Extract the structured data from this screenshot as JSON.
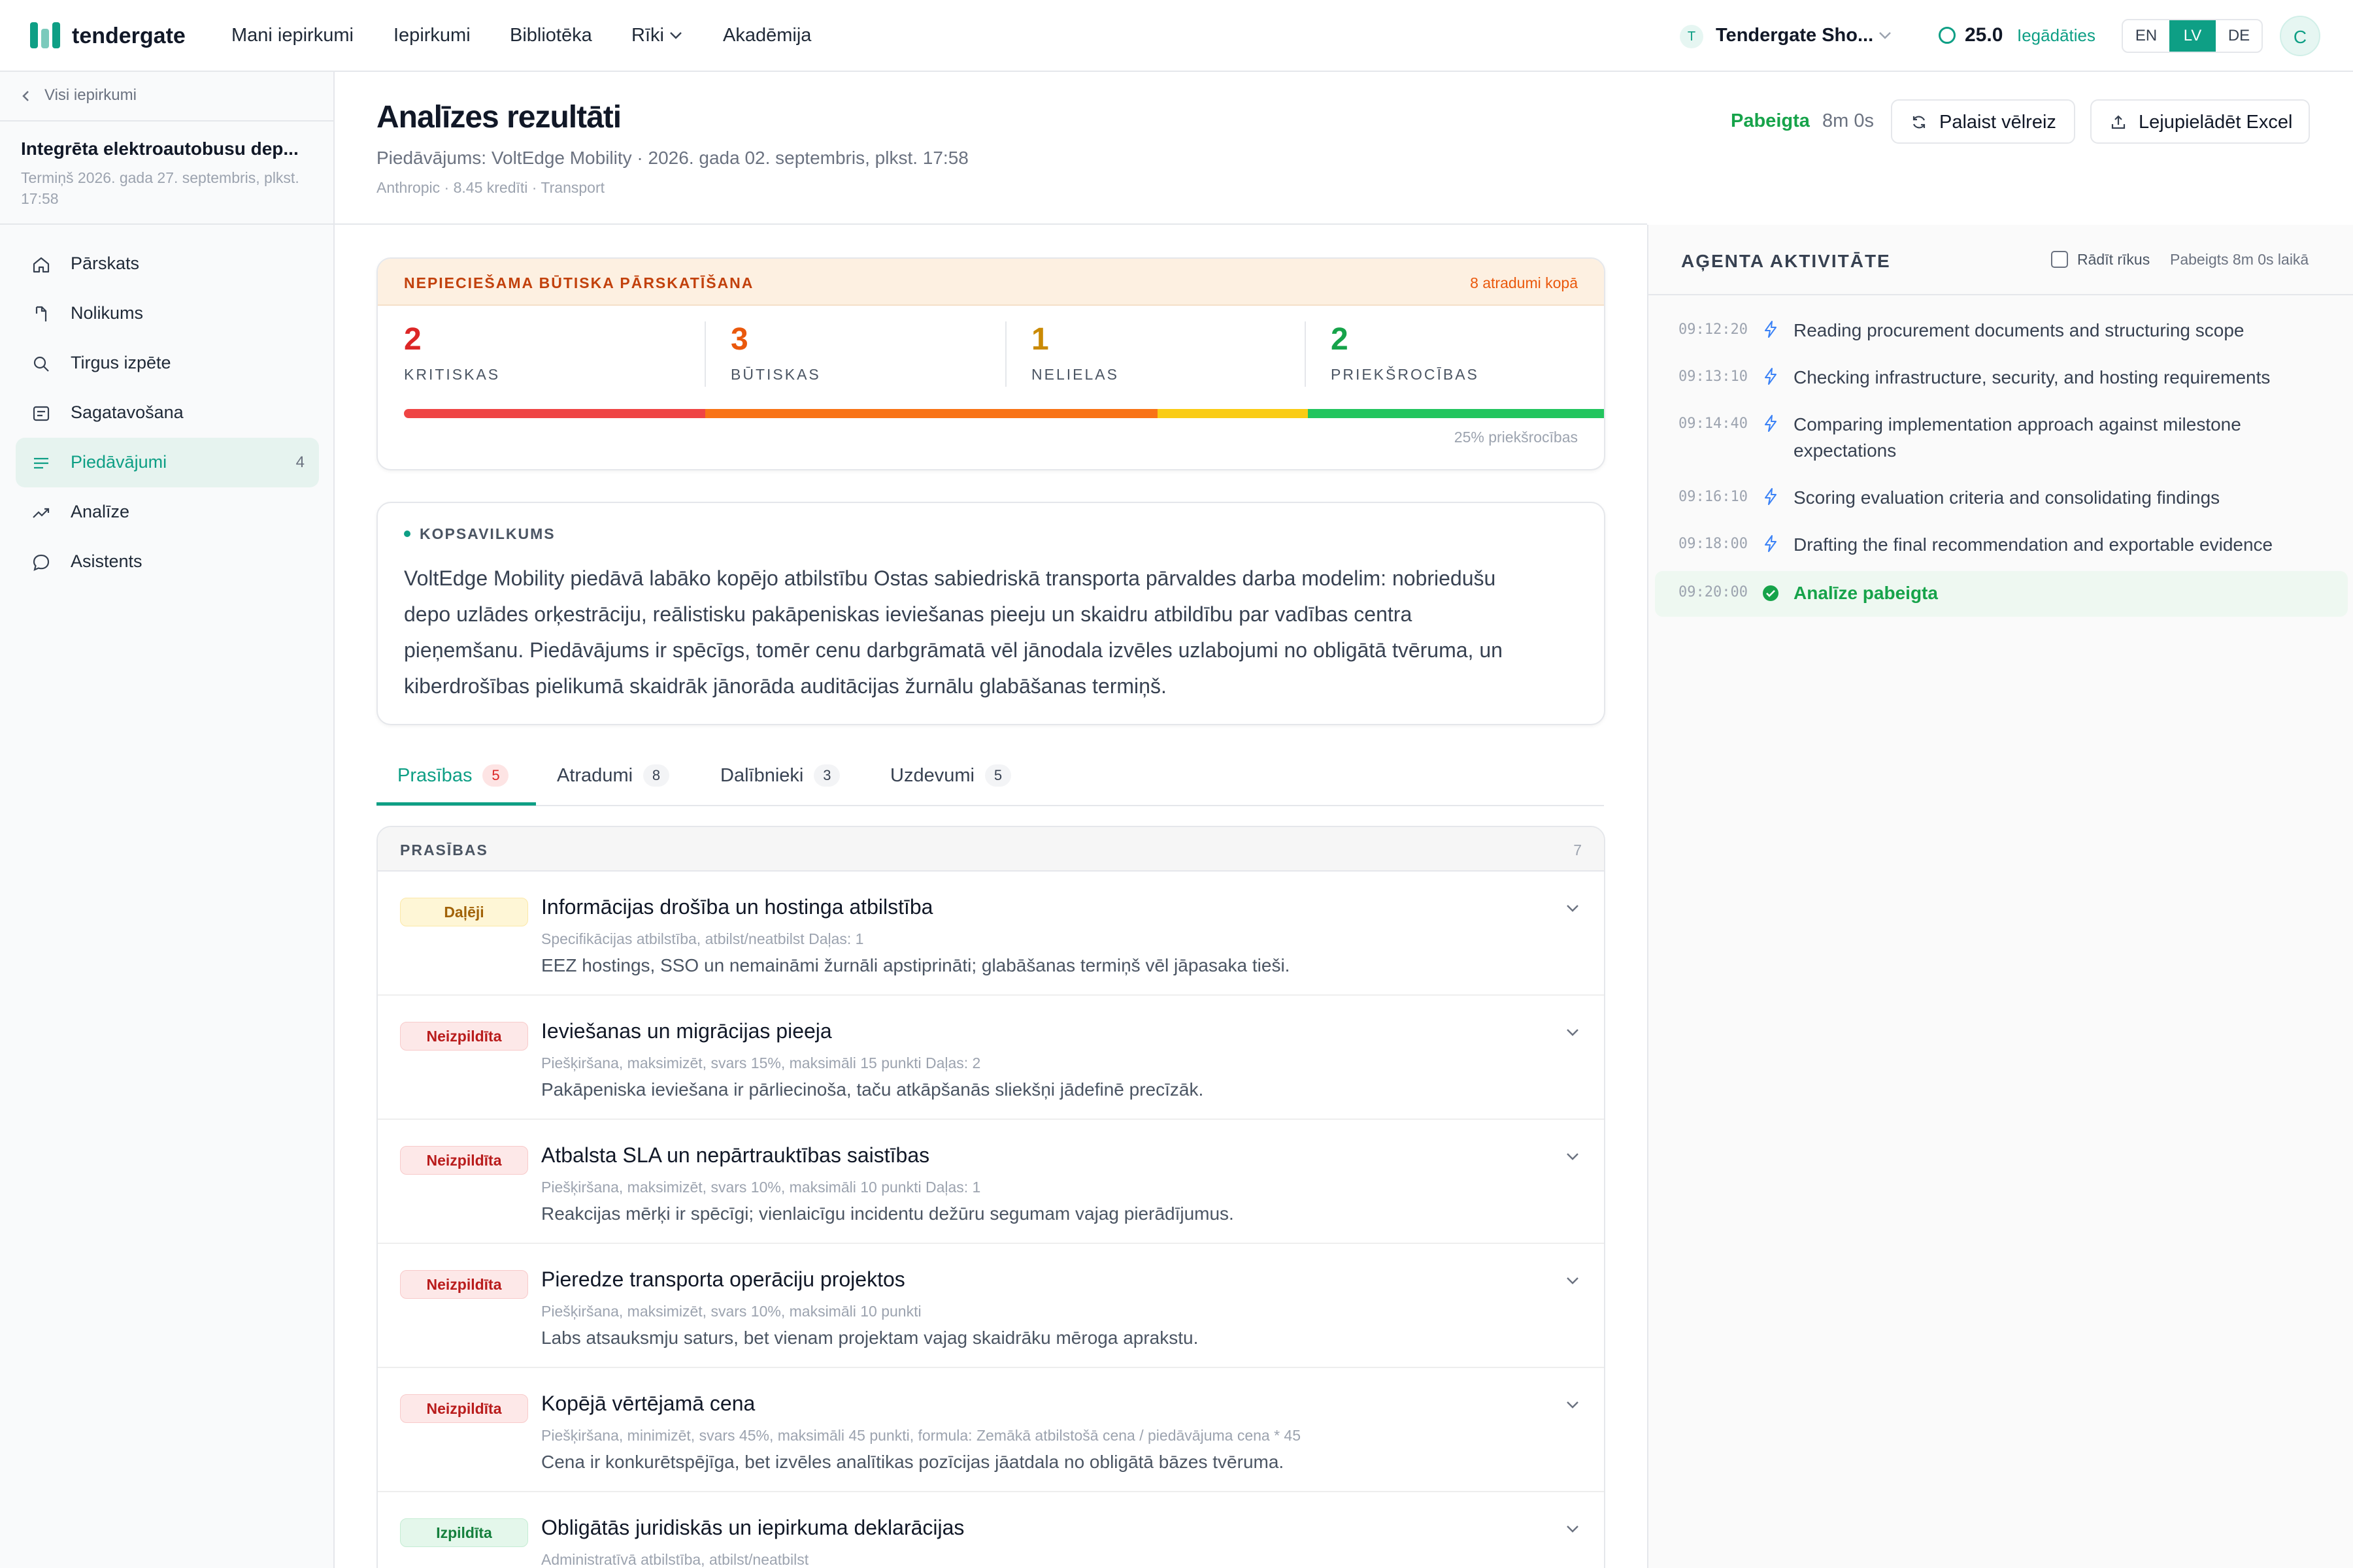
{
  "topbar": {
    "brand": "tendergate",
    "nav": [
      "Mani iepirkumi",
      "Iepirkumi",
      "Bibliotēka",
      "Rīki",
      "Akadēmija"
    ],
    "workspace_initial": "T",
    "workspace_name": "Tendergate Sho...",
    "credits": "25.0",
    "credits_link": "Iegādāties",
    "languages": [
      "EN",
      "LV",
      "DE"
    ],
    "active_language": "LV",
    "user_initial": "C"
  },
  "sidebar": {
    "back_label": "Visi iepirkumi",
    "project_title": "Integrēta elektroautobusu dep...",
    "project_deadline": "Termiņš 2026. gada 27. septembris, plkst. 17:58",
    "items": [
      {
        "label": "Pārskats",
        "icon": "home-icon"
      },
      {
        "label": "Nolikums",
        "icon": "document-icon"
      },
      {
        "label": "Tirgus izpēte",
        "icon": "search-icon"
      },
      {
        "label": "Sagatavošana",
        "icon": "form-icon"
      },
      {
        "label": "Piedāvājumi",
        "icon": "list-icon",
        "count": "4",
        "active": true
      },
      {
        "label": "Analīze",
        "icon": "trend-icon"
      },
      {
        "label": "Asistents",
        "icon": "chat-icon"
      }
    ]
  },
  "header": {
    "title": "Analīzes rezultāti",
    "meta": "Piedāvājums: VoltEdge Mobility · 2026. gada 02. septembris, plkst. 17:58",
    "tags": "Anthropic  ·  8.45 kredīti  ·  Transport",
    "status": "Pabeigta",
    "duration": "8m 0s",
    "rerun_label": "Palaist vēlreiz",
    "download_label": "Lejupielādēt Excel"
  },
  "severity": {
    "title": "NEPIECIEŠAMA BŪTISKA PĀRSKATĪŠANA",
    "total": "8 atradumi kopā",
    "stats": [
      {
        "value": "2",
        "label": "KRITISKAS",
        "color": "#dc2626"
      },
      {
        "value": "3",
        "label": "BŪTISKAS",
        "color": "#ea580c"
      },
      {
        "value": "1",
        "label": "NELIELAS",
        "color": "#ca8a04"
      },
      {
        "value": "2",
        "label": "PRIEKŠROCĪBAS",
        "color": "#16a34a"
      }
    ],
    "bar_colors": [
      "#ef4444",
      "#f97316",
      "#facc15",
      "#22c55e"
    ],
    "note": "25% priekšrocības"
  },
  "summary": {
    "heading": "KOPSAVILKUMS",
    "text": "VoltEdge Mobility piedāvā labāko kopējo atbilstību Ostas sabiedriskā transporta pārvaldes darba modelim: nobriedušu depo uzlādes orķestrāciju, reālistisku pakāpeniskas ieviešanas pieeju un skaidru atbildību par vadības centra pieņemšanu. Piedāvājums ir spēcīgs, tomēr cenu darbgrāmatā vēl jānodala izvēles uzlabojumi no obligātā tvēruma, un kiberdrošības pielikumā skaidrāk jānorāda auditācijas žurnālu glabāšanas termiņš."
  },
  "tabs": [
    {
      "label": "Prasības",
      "count": "5",
      "active": true
    },
    {
      "label": "Atradumi",
      "count": "8"
    },
    {
      "label": "Dalībnieki",
      "count": "3"
    },
    {
      "label": "Uzdevumi",
      "count": "5"
    }
  ],
  "requirements": {
    "heading": "PRASĪBAS",
    "count": "7",
    "rows": [
      {
        "status": "Daļēji",
        "kind": "partial",
        "title": "Informācijas drošība un hostinga atbilstība",
        "meta": "Specifikācijas atbilstība, atbilst/neatbilst  Daļas: 1",
        "desc": "EEZ hostings, SSO un nemaināmi žurnāli apstiprināti; glabāšanas termiņš vēl jāpasaka tieši."
      },
      {
        "status": "Neizpildīta",
        "kind": "fail",
        "title": "Ieviešanas un migrācijas pieeja",
        "meta": "Piešķiršana, maksimizēt, svars 15%, maksimāli 15 punkti  Daļas: 2",
        "desc": "Pakāpeniska ieviešana ir pārliecinoša, taču atkāpšanās sliekšņi jādefinē precīzāk."
      },
      {
        "status": "Neizpildīta",
        "kind": "fail",
        "title": "Atbalsta SLA un nepārtrauktības saistības",
        "meta": "Piešķiršana, maksimizēt, svars 10%, maksimāli 10 punkti  Daļas: 1",
        "desc": "Reakcijas mērķi ir spēcīgi; vienlaicīgu incidentu dežūru segumam vajag pierādījumus."
      },
      {
        "status": "Neizpildīta",
        "kind": "fail",
        "title": "Pieredze transporta operāciju projektos",
        "meta": "Piešķiršana, maksimizēt, svars 10%, maksimāli 10 punkti",
        "desc": "Labs atsauksmju saturs, bet vienam projektam vajag skaidrāku mēroga aprakstu."
      },
      {
        "status": "Neizpildīta",
        "kind": "fail",
        "title": "Kopējā vērtējamā cena",
        "meta": "Piešķiršana, minimizēt, svars 45%, maksimāli 45 punkti, formula: Zemākā atbilstošā cena / piedāvājuma cena * 45",
        "desc": "Cena ir konkurētspējīga, bet izvēles analītikas pozīcijas jāatdala no obligātā bāzes tvēruma."
      },
      {
        "status": "Izpildīta",
        "kind": "pass",
        "title": "Obligātās juridiskās un iepirkuma deklarācijas",
        "meta": "Administratīvā atbilstība, atbilst/neatbilst",
        "desc": ""
      }
    ]
  },
  "agent": {
    "title": "AĢENTA AKTIVITĀTE",
    "show_tools": "Rādīt rīkus",
    "done_text": "Pabeigts 8m 0s laikā",
    "events": [
      {
        "time": "09:12:20",
        "text": "Reading procurement documents and structuring scope",
        "kind": "step"
      },
      {
        "time": "09:13:10",
        "text": "Checking infrastructure, security, and hosting requirements",
        "kind": "step"
      },
      {
        "time": "09:14:40",
        "text": "Comparing implementation approach against milestone expectations",
        "kind": "step"
      },
      {
        "time": "09:16:10",
        "text": "Scoring evaluation criteria and consolidating findings",
        "kind": "step"
      },
      {
        "time": "09:18:00",
        "text": "Drafting the final recommendation and exportable evidence",
        "kind": "step"
      },
      {
        "time": "09:20:00",
        "text": "Analīze pabeigta",
        "kind": "done"
      }
    ]
  }
}
